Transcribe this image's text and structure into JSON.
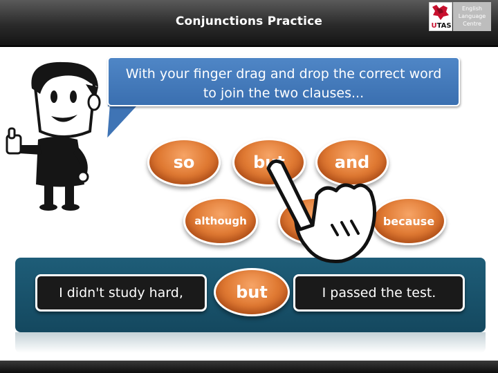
{
  "header": {
    "title": "Conjunctions Practice",
    "logo": {
      "utas_text": "UTAS",
      "box_lines": [
        "English",
        "Language",
        "Centre"
      ]
    }
  },
  "instruction": {
    "line1": "With your finger drag and drop the correct word",
    "line2": "to join the two clauses..."
  },
  "word_bank": {
    "so": "so",
    "but": "but",
    "and": "and",
    "although": "although",
    "because": "because"
  },
  "sentence": {
    "clause_left": "I didn't study hard,",
    "answer": "but",
    "clause_right": "I passed the test."
  },
  "colors": {
    "header_bg": "#2a2a2a",
    "bubble": "#4a80c0",
    "word_orange": "#e07a33",
    "band": "#1a5670",
    "clause_bg": "#1a1a1a"
  },
  "icons": [
    "thumbs-up-character",
    "pointing-hand-icon",
    "utas-crest-logo"
  ]
}
